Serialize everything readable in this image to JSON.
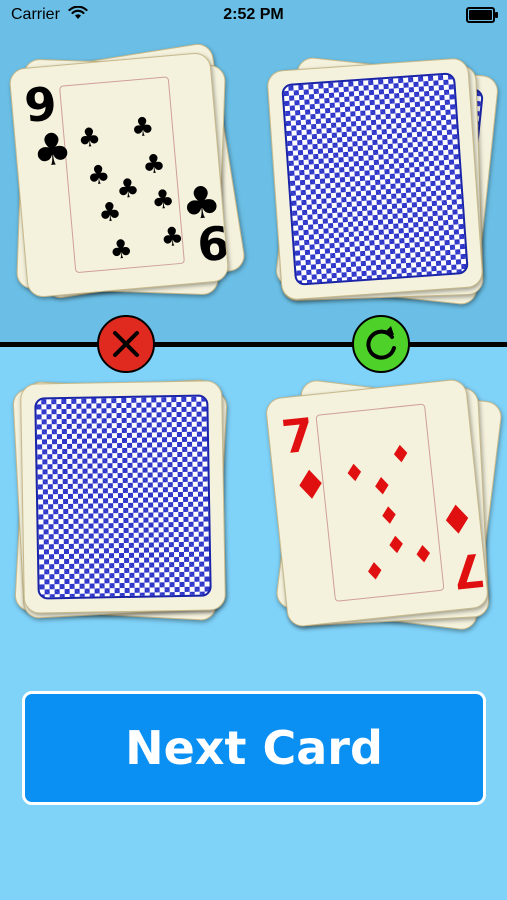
{
  "status_bar": {
    "carrier": "Carrier",
    "time": "2:52 PM",
    "wifi_icon": "wifi-icon",
    "battery_icon": "battery-icon"
  },
  "cards": {
    "top_left": {
      "rank": "9",
      "rank_bottom": "6",
      "suit": "clubs",
      "color": "#000000"
    },
    "top_right": {
      "side": "back"
    },
    "bottom_left": {
      "side": "back"
    },
    "bottom_right": {
      "rank": "7",
      "rank_bottom": "7",
      "suit": "diamonds",
      "color": "#e11010"
    }
  },
  "controls": {
    "wrong_icon": "close-icon",
    "flip_icon": "refresh-icon",
    "next_label": "Next Card"
  },
  "colors": {
    "top_background": "#6bbfe6",
    "bottom_background": "#7fd2f8",
    "card_back": "#2b33c9",
    "next_button": "#0a8ff3",
    "wrong_button": "#e02a1f",
    "flip_button": "#4ed22a"
  }
}
